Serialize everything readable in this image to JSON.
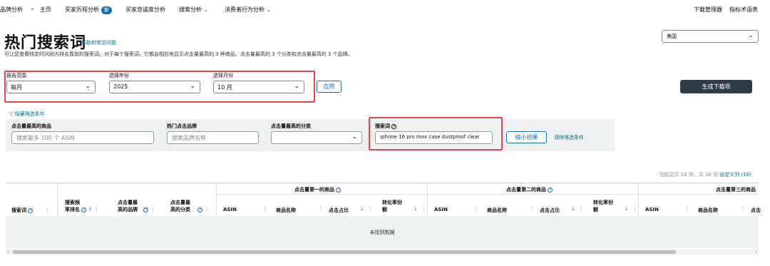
{
  "topnav": {
    "brand_analytics": "品牌分析",
    "sep": "»",
    "home": "主页",
    "customer_journey": "买家历程分析",
    "new_badge": "新",
    "loyalty": "买家忠诚度分析",
    "search_analysis": "搜索分析",
    "consumer_behavior": "消费者行为分析",
    "download_manager": "下载管理器",
    "metric_glossary": "指标术语表"
  },
  "header": {
    "title": "热门搜索词",
    "help_link": "帮助和常见问题",
    "description": "可让您查看特定时间段内排名靠前的搜索词。对于每个搜索词，它都会相应地显示点击量最高的 3 种商品、点击量最高的 3 个分类和点击量最高的 3 个品牌。"
  },
  "country": {
    "value": "美国"
  },
  "reporting": {
    "range_label": "报告范围",
    "range_value": "每月",
    "year_label": "选择年份",
    "year_value": "2025",
    "month_label": "选择月份",
    "month_value": "10 月",
    "apply_label": "应用",
    "generate_label": "生成下载项"
  },
  "filters": {
    "toggle_label": "隐藏筛选条件",
    "asin_label": "点击量最高的商品",
    "asin_placeholder": "搜索最多 100 个 ASIN",
    "brand_label": "热门点击品牌",
    "brand_placeholder": "搜索品牌名称",
    "category_label": "点击量最高的分类",
    "category_value": "",
    "search_term_label": "搜索词",
    "search_term_value": "iphone 16 pro max case dustproof clear",
    "narrow_label": "缩小结果",
    "clear_label": "清除筛选条件"
  },
  "table_info": {
    "showing": "当前显示 16 列，共 16 列",
    "customize": "自定义列 (16)"
  },
  "table": {
    "group_1": "点击量第一的商品",
    "group_2": "点击量第二的商品",
    "group_3": "点击量第三的商品",
    "col_search_term": "搜索词",
    "col_rank_line1": "搜索频",
    "col_rank_line2": "率排名",
    "col_brand_line1": "点击量最",
    "col_brand_line2": "高的品牌",
    "col_category_line1": "点击量最",
    "col_category_line2": "高的分类",
    "col_asin": "ASIN",
    "col_product_name": "商品名称",
    "col_click_share": "点击占比",
    "col_conversion_line1": "转化率份",
    "col_conversion_line2": "额",
    "col_click_share_trunc": "点击",
    "no_data": "未找到数据"
  }
}
